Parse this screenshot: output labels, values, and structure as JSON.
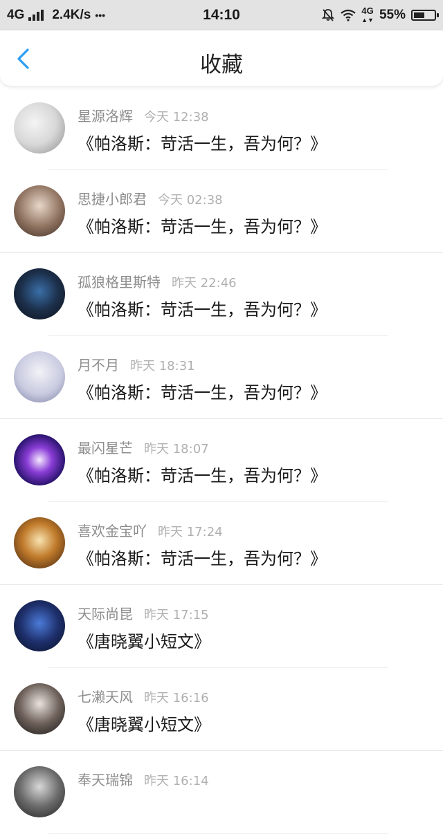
{
  "status_bar": {
    "network_type": "4G",
    "speed": "2.4K/s",
    "dots": "•••",
    "time": "14:10",
    "mobile_data": "4G",
    "battery": "55%",
    "battery_level": 0.55
  },
  "header": {
    "title": "收藏"
  },
  "favorites": [
    {
      "user": "星源洛辉",
      "time": "今天 12:38",
      "work": "《帕洛斯：苛活一生，吾为何？》"
    },
    {
      "user": "思捷小郎君",
      "time": "今天 02:38",
      "work": "《帕洛斯：苛活一生，吾为何？》"
    },
    {
      "user": "孤狼格里斯特",
      "time": "昨天 22:46",
      "work": "《帕洛斯：苛活一生，吾为何？》"
    },
    {
      "user": "月不月",
      "time": "昨天 18:31",
      "work": "《帕洛斯：苛活一生，吾为何？》"
    },
    {
      "user": "最闪星芒",
      "time": "昨天 18:07",
      "work": "《帕洛斯：苛活一生，吾为何？》"
    },
    {
      "user": "喜欢金宝吖",
      "time": "昨天 17:24",
      "work": "《帕洛斯：苛活一生，吾为何？》"
    },
    {
      "user": "天际尚昆",
      "time": "昨天 17:15",
      "work": "《唐晓翼小短文》"
    },
    {
      "user": "七濑天风",
      "time": "昨天 16:16",
      "work": "《唐晓翼小短文》"
    },
    {
      "user": "奉天瑞锦",
      "time": "昨天 16:14",
      "work": ""
    }
  ],
  "colors": {
    "accent": "#2a9df4",
    "status_bar_bg": "#e3e3e3",
    "name_text": "#8c8c8c",
    "time_text": "#b0b0b0"
  }
}
